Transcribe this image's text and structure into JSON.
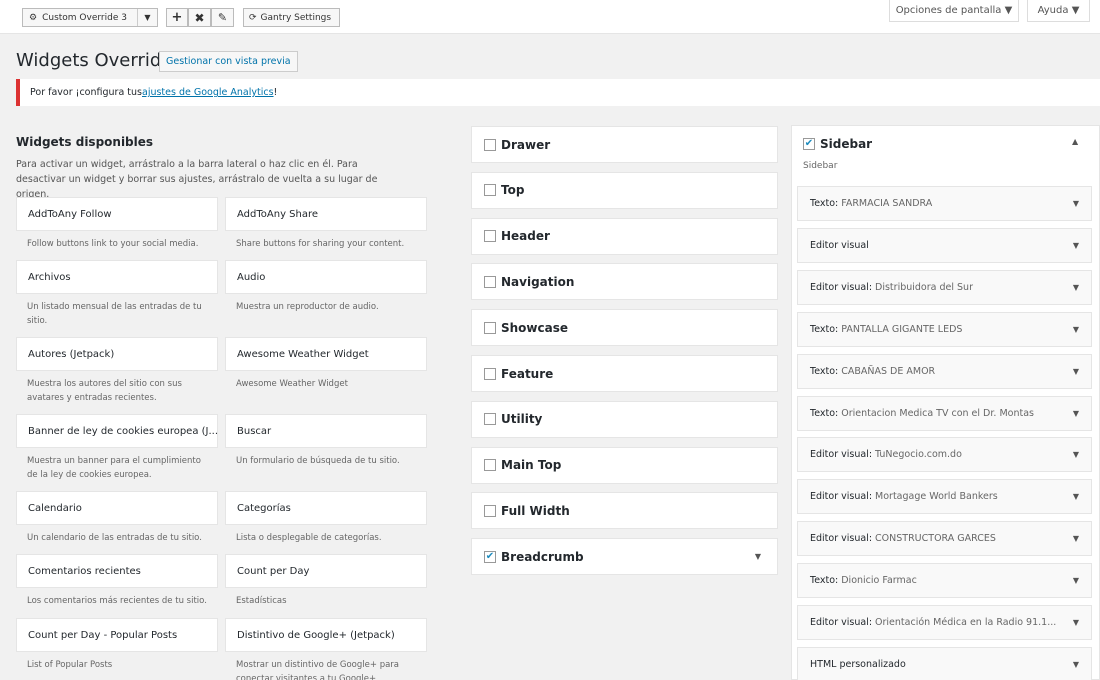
{
  "toolbar": {
    "override_select": "Custom Override 3",
    "gantry_settings": "Gantry Settings",
    "screen_options": "Opciones de pantalla",
    "help": "Ayuda"
  },
  "page": {
    "title": "Widgets Override",
    "preview_button": "Gestionar con vista previa"
  },
  "notice": {
    "before": "Por favor ¡configura tus ",
    "link": "ajustes de Google Analytics",
    "after": "!"
  },
  "available": {
    "title": "Widgets disponibles",
    "description": "Para activar un widget, arrástralo a la barra lateral o haz clic en él. Para desactivar un widget y borrar sus ajustes, arrástralo de vuelta a su lugar de origen.",
    "widgets": [
      {
        "name": "AddToAny Follow",
        "desc": "Follow buttons link to your social media."
      },
      {
        "name": "AddToAny Share",
        "desc": "Share buttons for sharing your content."
      },
      {
        "name": "Archivos",
        "desc": "Un listado mensual de las entradas de tu sitio."
      },
      {
        "name": "Audio",
        "desc": "Muestra un reproductor de audio."
      },
      {
        "name": "Autores (Jetpack)",
        "desc": "Muestra los autores del sitio con sus avatares y entradas recientes."
      },
      {
        "name": "Awesome Weather Widget",
        "desc": "Awesome Weather Widget"
      },
      {
        "name": "Banner de ley de cookies europea (J...",
        "desc": "Muestra un banner para el cumplimiento de la ley de cookies europea."
      },
      {
        "name": "Buscar",
        "desc": "Un formulario de búsqueda de tu sitio."
      },
      {
        "name": "Calendario",
        "desc": "Un calendario de las entradas de tu sitio."
      },
      {
        "name": "Categorías",
        "desc": "Lista o desplegable de categorías."
      },
      {
        "name": "Comentarios recientes",
        "desc": "Los comentarios más recientes de tu sitio."
      },
      {
        "name": "Count per Day",
        "desc": "Estadísticas"
      },
      {
        "name": "Count per Day - Popular Posts",
        "desc": "List of Popular Posts"
      },
      {
        "name": "Distintivo de Google+ (Jetpack)",
        "desc": "Mostrar un distintivo de Google+ para conectar visitantes a tu Google+"
      }
    ]
  },
  "positions": [
    {
      "name": "Drawer",
      "checked": false
    },
    {
      "name": "Top",
      "checked": false
    },
    {
      "name": "Header",
      "checked": false
    },
    {
      "name": "Navigation",
      "checked": false
    },
    {
      "name": "Showcase",
      "checked": false
    },
    {
      "name": "Feature",
      "checked": false
    },
    {
      "name": "Utility",
      "checked": false
    },
    {
      "name": "Main Top",
      "checked": false
    },
    {
      "name": "Full Width",
      "checked": false
    },
    {
      "name": "Breadcrumb",
      "checked": true
    }
  ],
  "sidebar": {
    "title": "Sidebar",
    "subtitle": "Sidebar",
    "checked": true,
    "items": [
      {
        "type": "Texto",
        "title": "FARMACIA SANDRA"
      },
      {
        "type": "Editor visual",
        "title": ""
      },
      {
        "type": "Editor visual",
        "title": "Distribuidora del Sur"
      },
      {
        "type": "Texto",
        "title": "PANTALLA GIGANTE LEDS"
      },
      {
        "type": "Texto",
        "title": "CABAÑAS DE AMOR"
      },
      {
        "type": "Texto",
        "title": "Orientacion Medica TV con el Dr. Montas"
      },
      {
        "type": "Editor visual",
        "title": "TuNegocio.com.do"
      },
      {
        "type": "Editor visual",
        "title": "Mortagage World Bankers"
      },
      {
        "type": "Editor visual",
        "title": "CONSTRUCTORA GARCES"
      },
      {
        "type": "Texto",
        "title": "Dionicio Farmac"
      },
      {
        "type": "Editor visual",
        "title": "Orientación Médica en la Radio 91.1..."
      },
      {
        "type": "HTML personalizado",
        "title": ""
      }
    ]
  }
}
